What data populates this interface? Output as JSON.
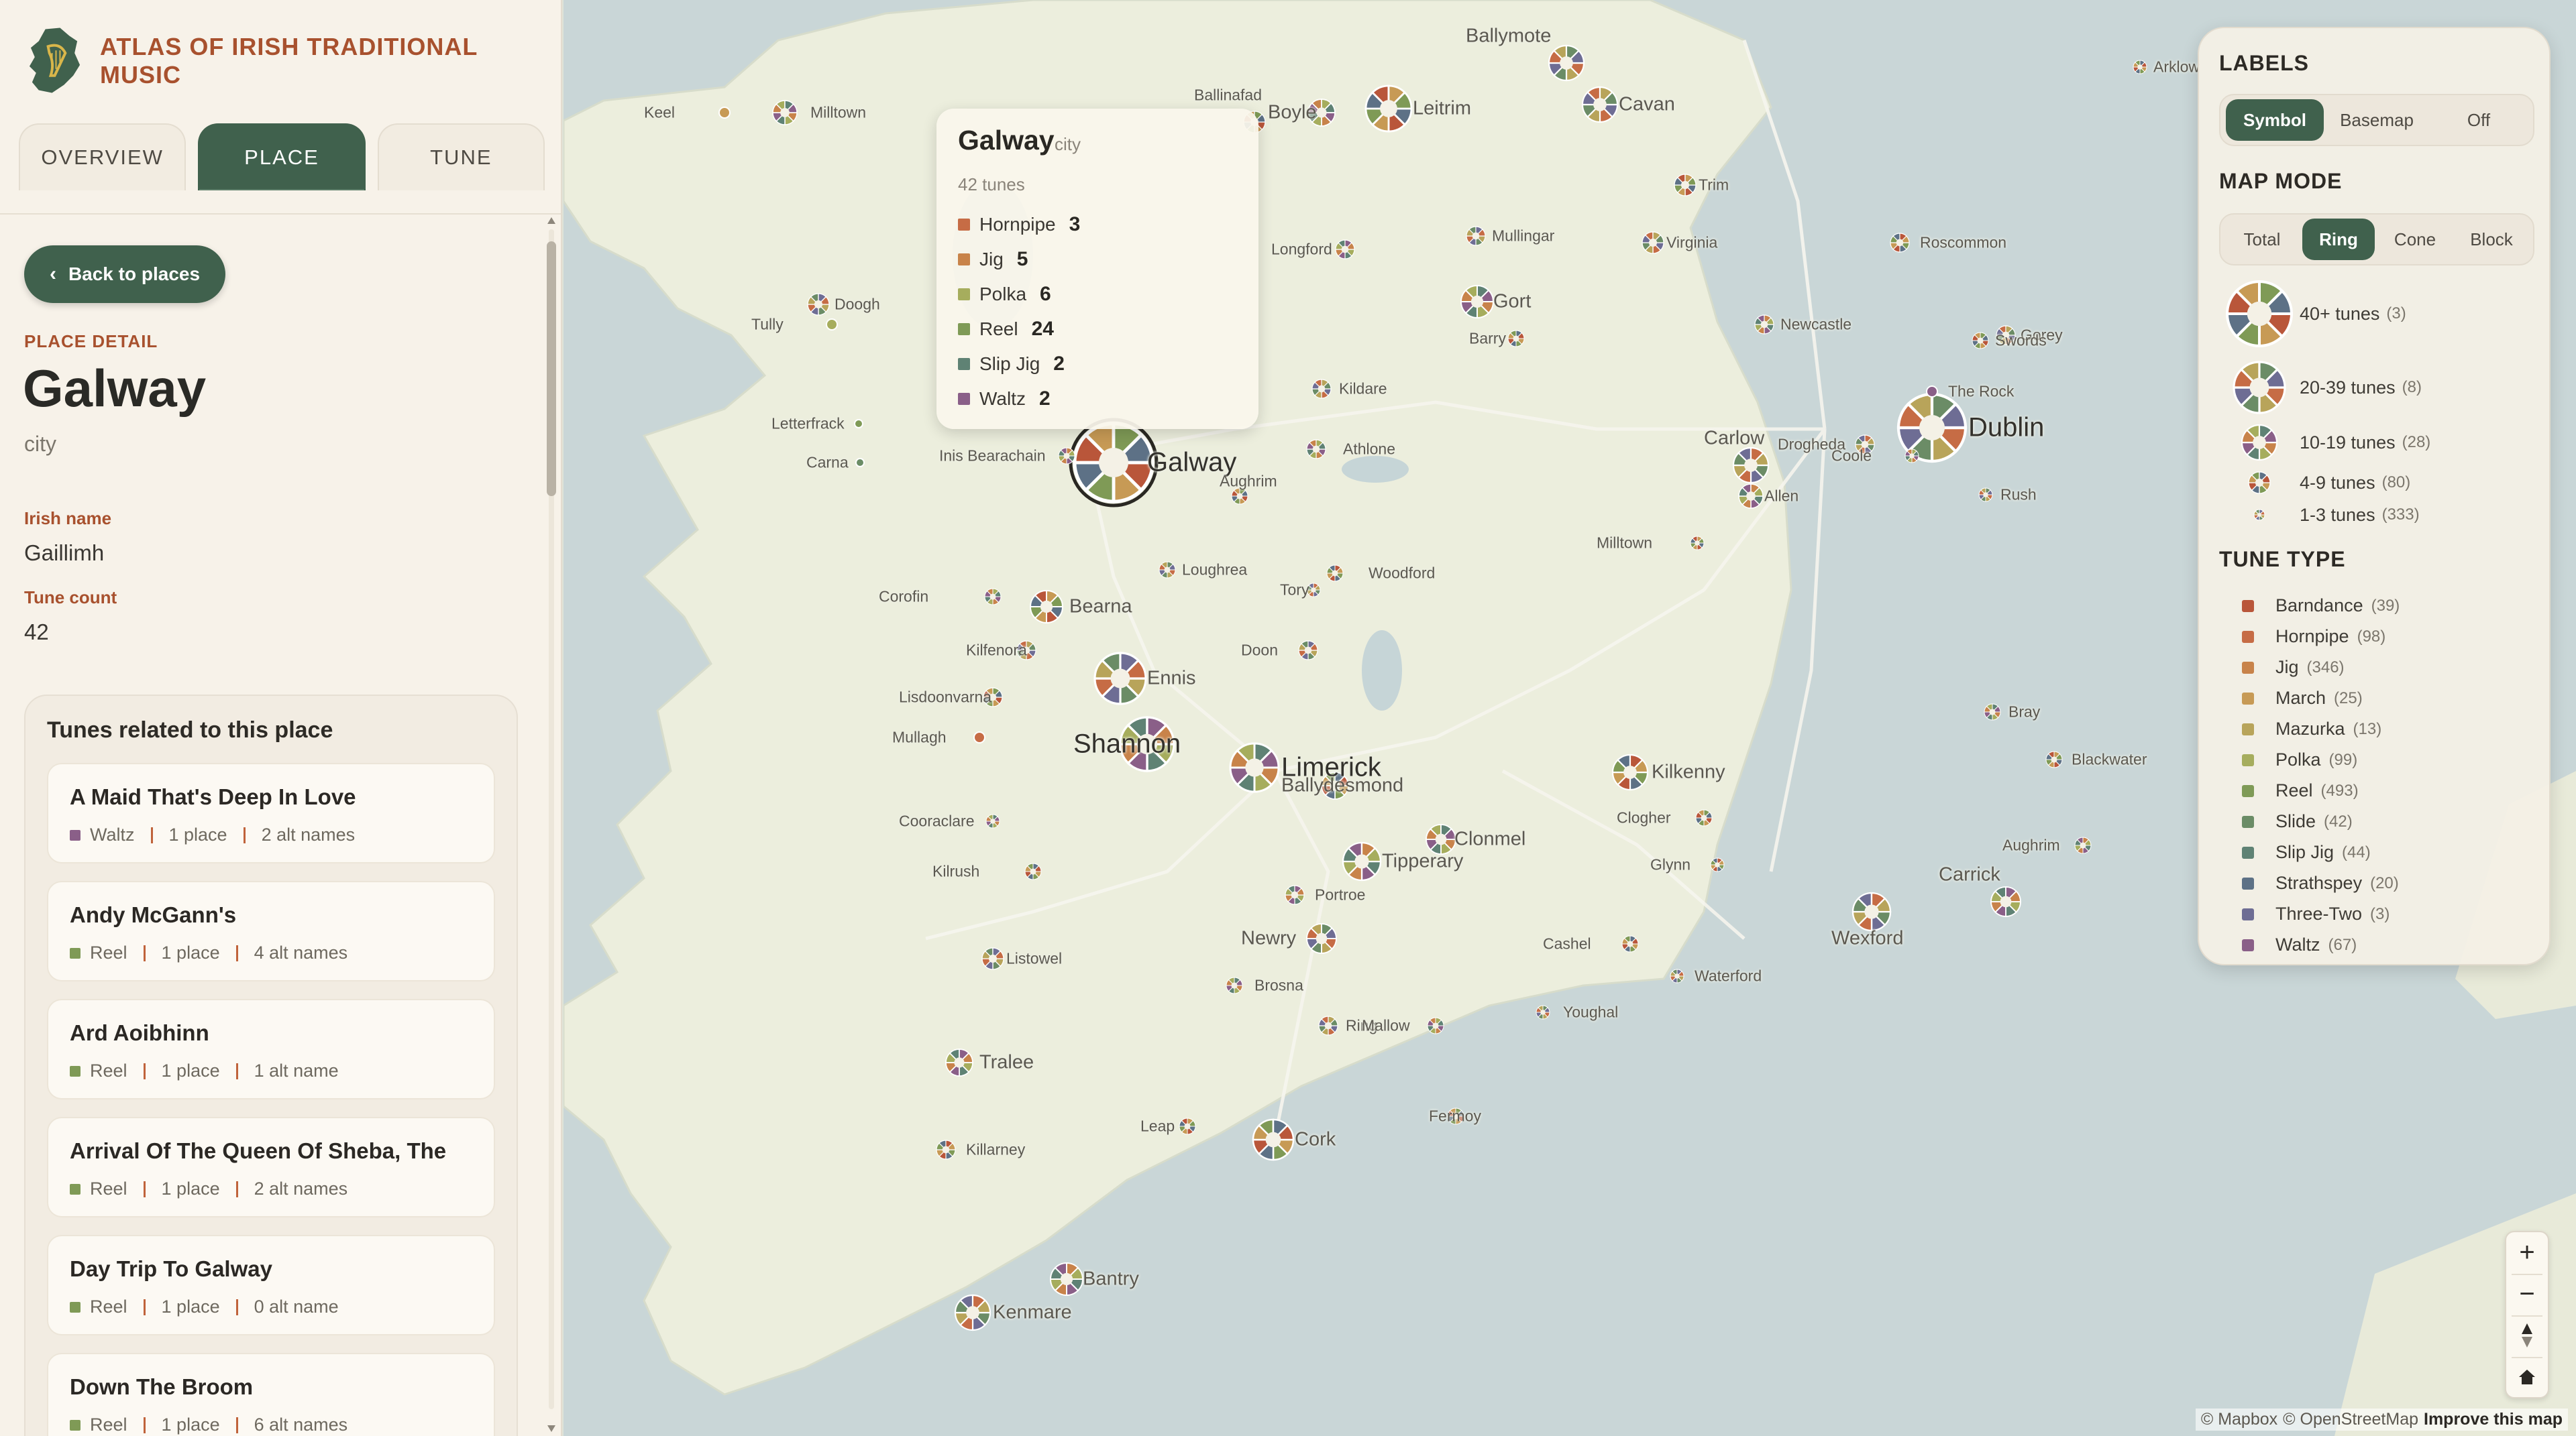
{
  "brand": {
    "name": "ATLAS OF IRISH TRADITIONAL MUSIC",
    "logo_icon": "ireland-harp-icon"
  },
  "tabs": [
    {
      "label": "OVERVIEW",
      "active": false
    },
    {
      "label": "PLACE",
      "active": true
    },
    {
      "label": "TUNE",
      "active": false
    }
  ],
  "detail": {
    "back_label": "Back to places",
    "kicker": "PLACE DETAIL",
    "title": "Galway",
    "kind": "city",
    "irish_name_label": "Irish name",
    "irish_name": "Gaillimh",
    "tune_count_label": "Tune count",
    "tune_count": "42"
  },
  "tunes": {
    "heading": "Tunes related to this place",
    "items": [
      {
        "title": "A Maid That's Deep In Love",
        "type": "Waltz",
        "places": "1 place",
        "alts": "2 alt names"
      },
      {
        "title": "Andy McGann's",
        "type": "Reel",
        "places": "1 place",
        "alts": "4 alt names"
      },
      {
        "title": "Ard Aoibhinn",
        "type": "Reel",
        "places": "1 place",
        "alts": "1 alt name"
      },
      {
        "title": "Arrival Of The Queen Of Sheba, The",
        "type": "Reel",
        "places": "1 place",
        "alts": "2 alt names"
      },
      {
        "title": "Day Trip To Galway",
        "type": "Reel",
        "places": "1 place",
        "alts": "0 alt name"
      },
      {
        "title": "Down The Broom",
        "type": "Reel",
        "places": "1 place",
        "alts": "6 alt names"
      }
    ]
  },
  "tune_type_colors": {
    "Barndance": "#b9563a",
    "Hornpipe": "#c66c45",
    "Jig": "#c8834a",
    "March": "#c79a55",
    "Mazurka": "#b8a45a",
    "Polka": "#a6ad5d",
    "Reel": "#7f9a56",
    "Slide": "#6b8c66",
    "Slip Jig": "#5f8274",
    "Strathspey": "#5d7186",
    "Three-Two": "#6e6d94",
    "Waltz": "#8a5f88"
  },
  "popup": {
    "title": "Galway",
    "kind": "city",
    "count": "42 tunes",
    "rows": [
      {
        "type": "Hornpipe",
        "value": "3"
      },
      {
        "type": "Jig",
        "value": "5"
      },
      {
        "type": "Polka",
        "value": "6"
      },
      {
        "type": "Reel",
        "value": "24"
      },
      {
        "type": "Slip Jig",
        "value": "2"
      },
      {
        "type": "Waltz",
        "value": "2"
      }
    ]
  },
  "legend": {
    "labels_heading": "LABELS",
    "labels_options": [
      "Symbol",
      "Basemap",
      "Off"
    ],
    "labels_active": "Symbol",
    "mode_heading": "MAP MODE",
    "mode_options": [
      "Total",
      "Ring",
      "Cone",
      "Block"
    ],
    "mode_active": "Ring",
    "sizes": [
      {
        "label": "40+ tunes",
        "count": "(3)"
      },
      {
        "label": "20-39 tunes",
        "count": "(8)"
      },
      {
        "label": "10-19 tunes",
        "count": "(28)"
      },
      {
        "label": "4-9 tunes",
        "count": "(80)"
      },
      {
        "label": "1-3 tunes",
        "count": "(333)"
      }
    ],
    "type_heading": "TUNE TYPE",
    "types": [
      {
        "label": "Barndance",
        "count": "(39)"
      },
      {
        "label": "Hornpipe",
        "count": "(98)"
      },
      {
        "label": "Jig",
        "count": "(346)"
      },
      {
        "label": "March",
        "count": "(25)"
      },
      {
        "label": "Mazurka",
        "count": "(13)"
      },
      {
        "label": "Polka",
        "count": "(99)"
      },
      {
        "label": "Reel",
        "count": "(493)"
      },
      {
        "label": "Slide",
        "count": "(42)"
      },
      {
        "label": "Slip Jig",
        "count": "(44)"
      },
      {
        "label": "Strathspey",
        "count": "(20)"
      },
      {
        "label": "Three-Two",
        "count": "(3)"
      },
      {
        "label": "Waltz",
        "count": "(67)"
      }
    ]
  },
  "map_places": [
    {
      "name": "Galway",
      "major": true
    },
    {
      "name": "Dublin",
      "major": true
    },
    {
      "name": "Limerick",
      "major": true
    },
    {
      "name": "Cork",
      "major": false
    },
    {
      "name": "Ennis",
      "major": false
    },
    {
      "name": "Shannon",
      "major": true
    },
    {
      "name": "Kilkenny",
      "major": false
    },
    {
      "name": "Wexford",
      "major": false
    },
    {
      "name": "Tipperary",
      "major": false
    },
    {
      "name": "Leitrim",
      "major": false
    },
    {
      "name": "Cavan",
      "major": false
    },
    {
      "name": "Boyle",
      "major": false
    },
    {
      "name": "Ballinafad",
      "major": false
    },
    {
      "name": "Ballymote",
      "major": false
    },
    {
      "name": "Milltown",
      "major": false
    },
    {
      "name": "Keel",
      "major": false
    },
    {
      "name": "Doogh",
      "major": false
    },
    {
      "name": "Tully",
      "major": false
    },
    {
      "name": "Letterfrack",
      "major": false
    },
    {
      "name": "Carna",
      "major": false
    },
    {
      "name": "Inis Bearachain",
      "major": false
    },
    {
      "name": "Bearna",
      "major": false
    },
    {
      "name": "Kilfenora",
      "major": false
    },
    {
      "name": "Corofin",
      "major": false
    },
    {
      "name": "Lisdoonvarna",
      "major": false
    },
    {
      "name": "Mullagh",
      "major": false
    },
    {
      "name": "Cooraclare",
      "major": false
    },
    {
      "name": "Kilrush",
      "major": false
    },
    {
      "name": "Listowel",
      "major": false
    },
    {
      "name": "Tralee",
      "major": false
    },
    {
      "name": "Killarney",
      "major": false
    },
    {
      "name": "Kenmare",
      "major": false
    },
    {
      "name": "Bantry",
      "major": false
    },
    {
      "name": "Leap",
      "major": false
    },
    {
      "name": "Ring",
      "major": false
    },
    {
      "name": "Mallow",
      "major": false
    },
    {
      "name": "Fermoy",
      "major": false
    },
    {
      "name": "Youghal",
      "major": false
    },
    {
      "name": "Clonmel",
      "major": false
    },
    {
      "name": "Cashel",
      "major": false
    },
    {
      "name": "Waterford",
      "major": false
    },
    {
      "name": "Carrick",
      "major": false
    },
    {
      "name": "Glynn",
      "major": false
    },
    {
      "name": "Carlow",
      "major": false
    },
    {
      "name": "Allen",
      "major": false
    },
    {
      "name": "Milltown",
      "major": false
    },
    {
      "name": "Kildare",
      "major": false
    },
    {
      "name": "Athlone",
      "major": false
    },
    {
      "name": "Aughrim",
      "major": false
    },
    {
      "name": "Loughrea",
      "major": false
    },
    {
      "name": "Gort",
      "major": false
    },
    {
      "name": "Barry",
      "major": false
    },
    {
      "name": "Mullingar",
      "major": false
    },
    {
      "name": "Longford",
      "major": false
    },
    {
      "name": "Roscommon",
      "major": false
    },
    {
      "name": "Drogheda",
      "major": false
    },
    {
      "name": "Newcastle",
      "major": false
    },
    {
      "name": "Trim",
      "major": false
    },
    {
      "name": "Virginia",
      "major": false
    },
    {
      "name": "Coole",
      "major": false
    },
    {
      "name": "Clogher",
      "major": false
    },
    {
      "name": "Newry",
      "major": false
    },
    {
      "name": "Brosna",
      "major": false
    },
    {
      "name": "Ballydesmond",
      "major": false
    },
    {
      "name": "Doon",
      "major": false
    },
    {
      "name": "Portroe",
      "major": false
    },
    {
      "name": "Woodford",
      "major": false
    },
    {
      "name": "Tory",
      "major": false
    },
    {
      "name": "Aughrim",
      "major": false
    },
    {
      "name": "Blackwater",
      "major": false
    },
    {
      "name": "Gorey",
      "major": false
    },
    {
      "name": "The Rock",
      "major": false
    },
    {
      "name": "Swords",
      "major": false
    },
    {
      "name": "Rush",
      "major": false
    },
    {
      "name": "Bray",
      "major": false
    },
    {
      "name": "Arklow",
      "major": false
    }
  ],
  "controls": {
    "zoom_in_icon": "plus-icon",
    "zoom_out_icon": "minus-icon",
    "compass_icon": "compass-icon",
    "home_icon": "home-icon"
  },
  "attribution": {
    "mapbox": "© Mapbox",
    "osm": "© OpenStreetMap",
    "improve": "Improve this map"
  }
}
